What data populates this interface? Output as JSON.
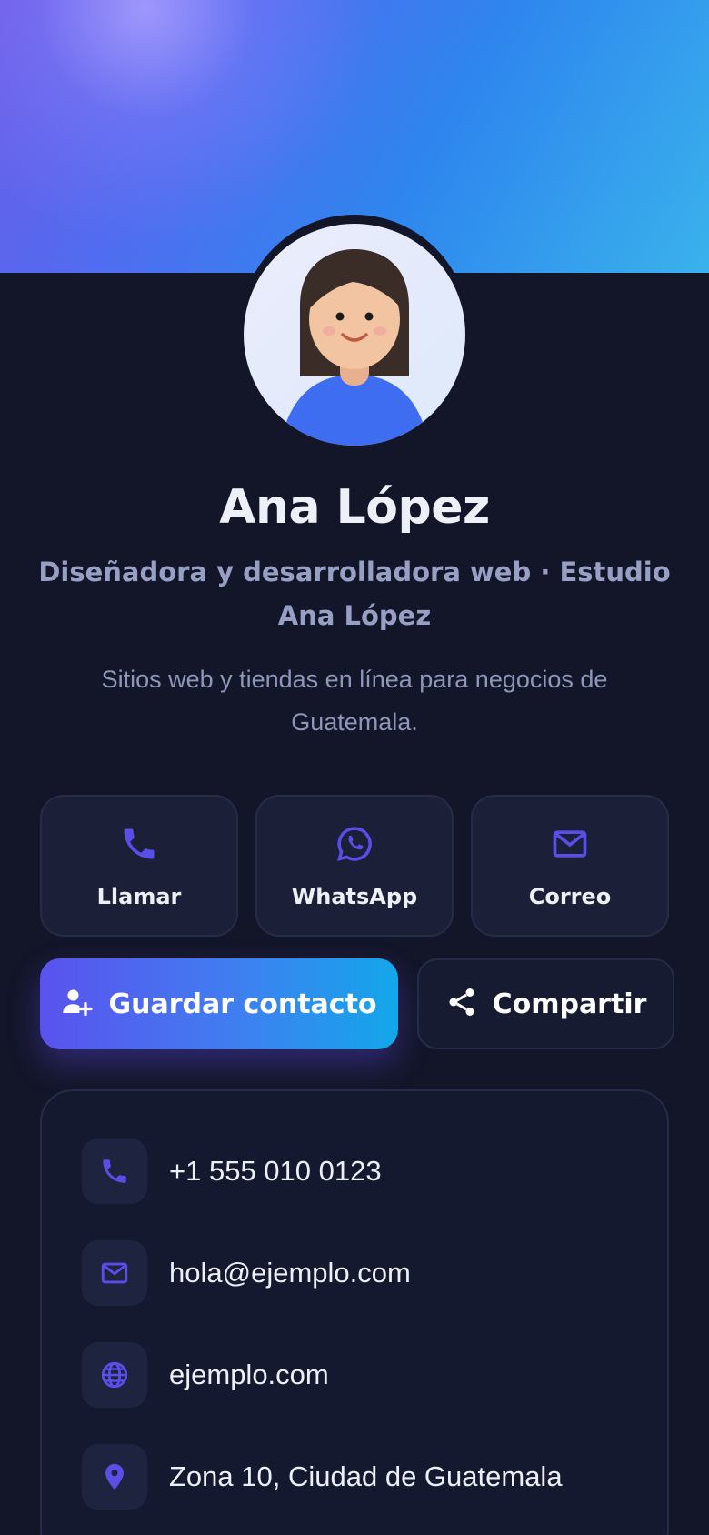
{
  "profile": {
    "name": "Ana López",
    "role": "Diseñadora y desarrolladora web · Estudio Ana López",
    "tagline": "Sitios web y tiendas en línea para negocios de Guatemala."
  },
  "quick_actions": [
    {
      "label": "Llamar",
      "icon": "phone-icon"
    },
    {
      "label": "WhatsApp",
      "icon": "whatsapp-icon"
    },
    {
      "label": "Correo",
      "icon": "mail-icon"
    }
  ],
  "buttons": {
    "save_label": "Guardar contacto",
    "save_icon": "add-user-icon",
    "share_label": "Compartir",
    "share_icon": "share-icon"
  },
  "contact_info": [
    {
      "icon": "phone-icon",
      "text": "+1 555 010 0123"
    },
    {
      "icon": "mail-icon",
      "text": "hola@ejemplo.com"
    },
    {
      "icon": "globe-icon",
      "text": "ejemplo.com"
    },
    {
      "icon": "location-pin-icon",
      "text": "Zona 10, Ciudad de Guatemala"
    }
  ],
  "colors": {
    "background": "#131629",
    "accent": "#5b4ee8",
    "accent_gradient_end": "#13a7ea",
    "card": "#1b1f37",
    "text_muted": "#97a0c4"
  }
}
